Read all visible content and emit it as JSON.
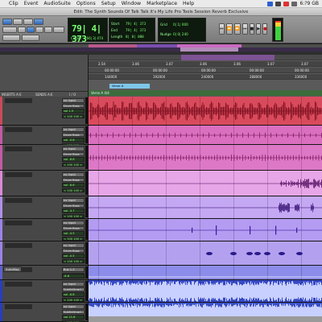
{
  "menubar": {
    "items": [
      "Clip",
      "Event",
      "AudioSuite",
      "Options",
      "Setup",
      "Window",
      "Marketplace",
      "Help"
    ],
    "clock": "6:?9 GB"
  },
  "window_title": "Edit: The Synth Sounds Of Talk Talk It's My Life Pro Tools Session Reverb Exclusive",
  "counter": {
    "main": "79| 4| 373",
    "sub_label": "Cursor",
    "sub_value": "166| 3| 474"
  },
  "selection": {
    "start_label": "Start",
    "start": "79| 4| 373",
    "end_label": "End",
    "end": "79| 4| 373",
    "length_label": "Length",
    "length": "0| 0| 000"
  },
  "grid": {
    "grid_label": "Grid",
    "grid_value": "0| 1| 000",
    "nudge_label": "Nudge",
    "nudge_value": "0| 0| 240"
  },
  "transport": [
    "⏮",
    "⏪",
    "⏩",
    "⏭",
    "■",
    "▶",
    "●"
  ],
  "columns": [
    "INSERTS A-E",
    "SENDS A-E",
    "I / O"
  ],
  "rulers": {
    "bars_ticks": [
      "2.54",
      "3.06",
      "3.07",
      "3.06",
      "3.06",
      "3.07",
      "3.07"
    ],
    "min_secs": [
      "00:00:00",
      "00:00:00",
      "00:00:00",
      "00:00:00",
      "00:00:00"
    ],
    "samples": [
      "144000",
      "192000",
      "240000",
      "288000",
      "336000"
    ]
  },
  "markers": {
    "marker_label": "Verse A",
    "section_label": "Verse A  4/4"
  },
  "tracks": [
    {
      "name": "Track 1",
      "input": "no input",
      "output": "Drum Buss",
      "vol": "vol  1.5",
      "pan": "< 100  100 >",
      "color": "#c84a5a",
      "lane": "#d94b5c",
      "wave": "#7a0f1f",
      "type": "dense"
    },
    {
      "name": "Track 2",
      "input": "no input",
      "output": "Drum Buss",
      "vol": "vol  -0.8",
      "pan": "< 100  100 >",
      "color": "#c45aa4",
      "lane": "#db6fbf",
      "wave": "#7a1a61",
      "type": "line"
    },
    {
      "name": "Track 3",
      "input": "no input",
      "output": "Drum Buss",
      "vol": "vol  -8.8",
      "pan": "< 100  100 >",
      "color": "#c45aa4",
      "lane": "#dd78c6",
      "wave": "#7a1a61",
      "type": "spiky"
    },
    {
      "name": "Track 4",
      "input": "no input",
      "output": "Drum Buss",
      "vol": "vol  -6.6",
      "pan": "< 100  100 >",
      "color": "#d98ad8",
      "lane": "#e7a6e7",
      "wave": "#5e1a6a",
      "type": "sparse1"
    },
    {
      "name": "Track 5",
      "input": "no input",
      "output": "Drum Buss",
      "vol": "vol  -3.7",
      "pan": "< 100  100 >",
      "color": "#b090e8",
      "lane": "#c5a8f4",
      "wave": "#3c1a7a",
      "type": "sparse2"
    },
    {
      "name": "Track 6",
      "input": "no input",
      "output": "Drum Buss",
      "vol": "vol  -4.5",
      "pan": "< 100  100 >",
      "color": "#9a84e8",
      "lane": "#b49cf2",
      "wave": "#3c1a9a",
      "type": "blips"
    },
    {
      "name": "Track 7",
      "input": "no input",
      "output": "Drum Buss",
      "vol": "vol  -0.5",
      "pan": "< 100  100 >",
      "color": "#9a84e8",
      "lane": "#b3a1f0",
      "wave": "#2b1a8a",
      "type": "notes"
    },
    {
      "name": "Track 8",
      "input": "Bus 1-2",
      "output": "SubSnDrop1-2",
      "vol": "-8.8",
      "pan": "< 100  100 >",
      "color": "#5f5fd0",
      "lane": "#8c8cea",
      "wave": "#7c7cf0",
      "type": "automation",
      "automation_label": "AutoMap"
    },
    {
      "name": "Track 9",
      "input": "no input",
      "output": "SubSnDrop1-2",
      "vol": "vol  -6.8",
      "pan": "< 100  100 >",
      "color": "#2a3dbb",
      "lane": "#3548c4",
      "wave": "#c8d0ff",
      "type": "full"
    },
    {
      "name": "Track 10",
      "input": "no input",
      "output": "SubSnDrop1-2",
      "vol": "vol  21.8",
      "pan": "< 100  100 >",
      "color": "#2a3dbb",
      "lane": "#3a4fc6",
      "wave": "#c8d0ff",
      "type": "full2"
    }
  ],
  "colors": {
    "counter_green": "#7dff74",
    "selection": "#a05ac8",
    "marker_cyan": "#7ec6e8"
  }
}
